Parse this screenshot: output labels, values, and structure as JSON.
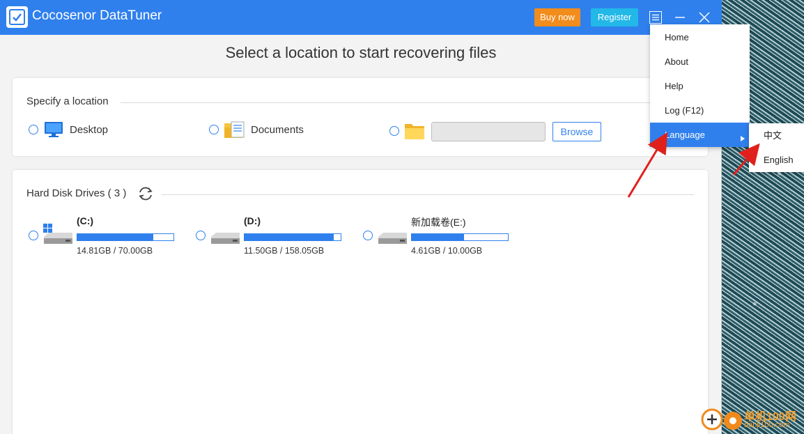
{
  "app": {
    "title": "Cocosenor DataTuner"
  },
  "titlebar": {
    "buy_label": "Buy now",
    "register_label": "Register"
  },
  "main": {
    "heading": "Select a location to start recovering files"
  },
  "location": {
    "section_title": "Specify a location",
    "desktop_label": "Desktop",
    "documents_label": "Documents",
    "path_value": "",
    "browse_label": "Browse"
  },
  "drives": {
    "section_title": "Hard Disk Drives ( 3 )",
    "items": [
      {
        "name": "(C:)",
        "size": "14.81GB / 70.00GB",
        "used_fraction": 0.79,
        "system": true
      },
      {
        "name": "(D:)",
        "size": "11.50GB / 158.05GB",
        "used_fraction": 0.93,
        "system": false
      },
      {
        "name": "新加载卷(E:)",
        "size": "4.61GB / 10.00GB",
        "used_fraction": 0.54,
        "system": false
      }
    ]
  },
  "menu": {
    "items": [
      "Home",
      "About",
      "Help",
      "Log (F12)",
      "Language"
    ],
    "active": "Language"
  },
  "language_submenu": {
    "items": [
      "中文",
      "English"
    ]
  },
  "watermark": {
    "line1": "单机100网",
    "line2": "danji100.com"
  },
  "colors": {
    "accent": "#2f80ed",
    "buy": "#f28c1c",
    "register": "#22b8e8",
    "arrow": "#e0201c"
  }
}
